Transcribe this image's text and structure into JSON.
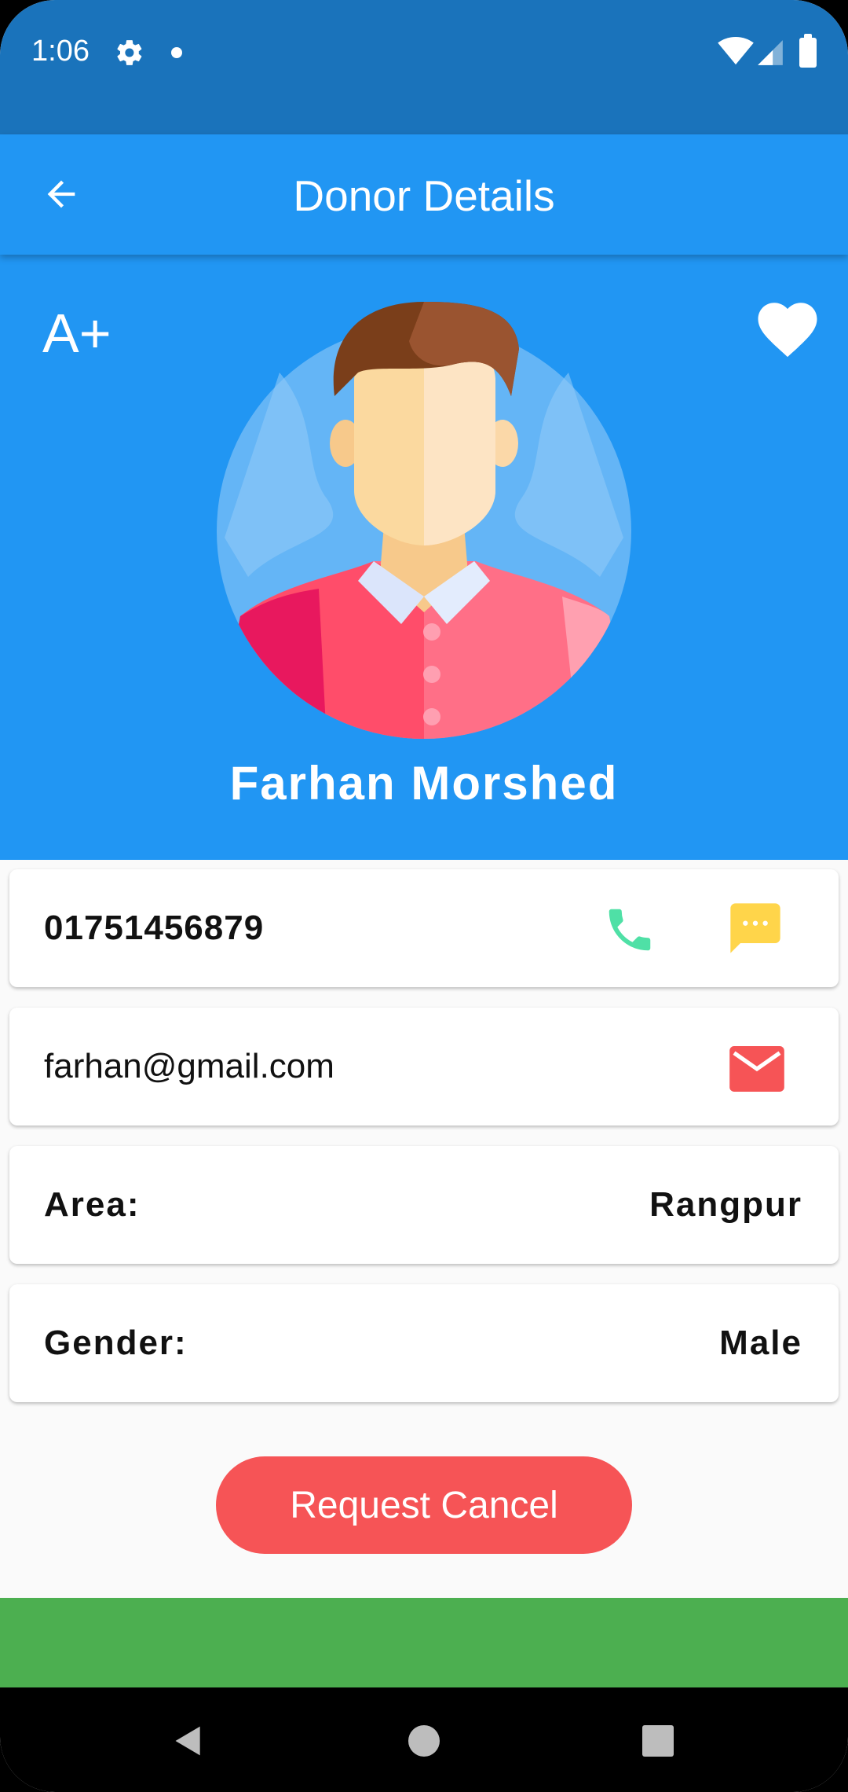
{
  "status_bar": {
    "time": "1:06"
  },
  "app_bar": {
    "title": "Donor Details"
  },
  "donor": {
    "blood_group": "A+",
    "name": "Farhan Morshed",
    "phone": "01751456879",
    "email": "farhan@gmail.com",
    "area_label": "Area:",
    "area": "Rangpur",
    "gender_label": "Gender:",
    "gender": "Male"
  },
  "actions": {
    "request_cancel": "Request Cancel"
  },
  "icons": {
    "back": "arrow-back-icon",
    "favorite": "heart-icon",
    "call": "phone-icon",
    "sms": "message-icon",
    "email": "mail-icon"
  },
  "colors": {
    "status_bar": "#1a73bb",
    "primary": "#2196f3",
    "call": "#4fe0a6",
    "sms": "#ffd54a",
    "email": "#f65456",
    "cancel": "#f65456",
    "bottom_strip": "#4caf50"
  }
}
